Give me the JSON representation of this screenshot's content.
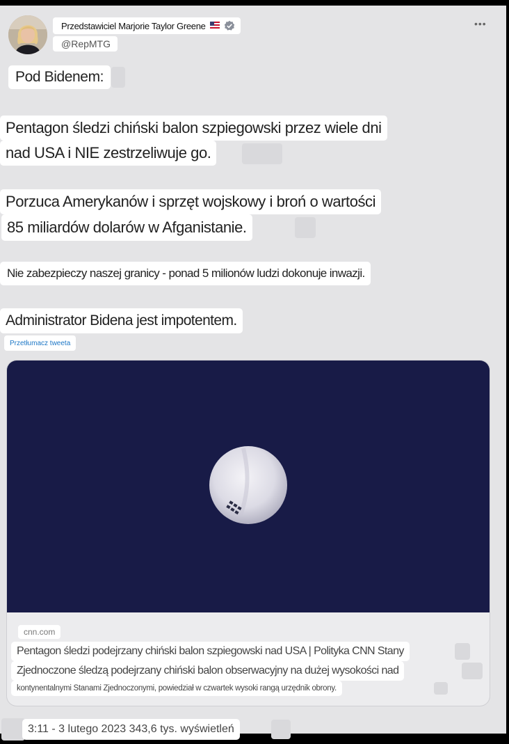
{
  "author": {
    "name": "Przedstawiciel Marjorie Taylor Greene",
    "handle": "@RepMTG",
    "flag_icon": "us-flag-icon",
    "verified_icon": "verified-badge-icon"
  },
  "menu": {
    "more_label": "•••"
  },
  "tweet": {
    "line1": "Pod Bidenem:",
    "line2a": "Pentagon śledzi chiński balon szpiegowski przez wiele dni",
    "line2b": "nad USA i NIE zestrzeliwuje go.",
    "line3a": "Porzuca Amerykanów i sprzęt wojskowy i broń o wartości",
    "line3b": "85 miliardów dolarów w Afganistanie.",
    "line4": "Nie zabezpieczy naszej granicy - ponad 5 milionów ludzi dokonuje inwazji.",
    "line5": "Administrator Bidena jest impotentem.",
    "translate_label": "Przetłumacz tweeta"
  },
  "card": {
    "domain": "cnn.com",
    "title": "Pentagon śledzi podejrzany chiński balon szpiegowski nad USA | Polityka CNN Stany",
    "desc_line1": "Zjednoczone śledzą podejrzany chiński balon obserwacyjny na dużej wysokości nad",
    "desc_line2": "kontynentalnymi Stanami Zjednoczonymi, powiedział w czwartek wysoki rangą urzędnik obrony."
  },
  "footer": {
    "meta": "3:11 - 3 lutego 2023 343,6 tys. wyświetleń"
  },
  "colors": {
    "background": "#e4e4e6",
    "image_sky": "#181b47",
    "link": "#1d77c6"
  }
}
